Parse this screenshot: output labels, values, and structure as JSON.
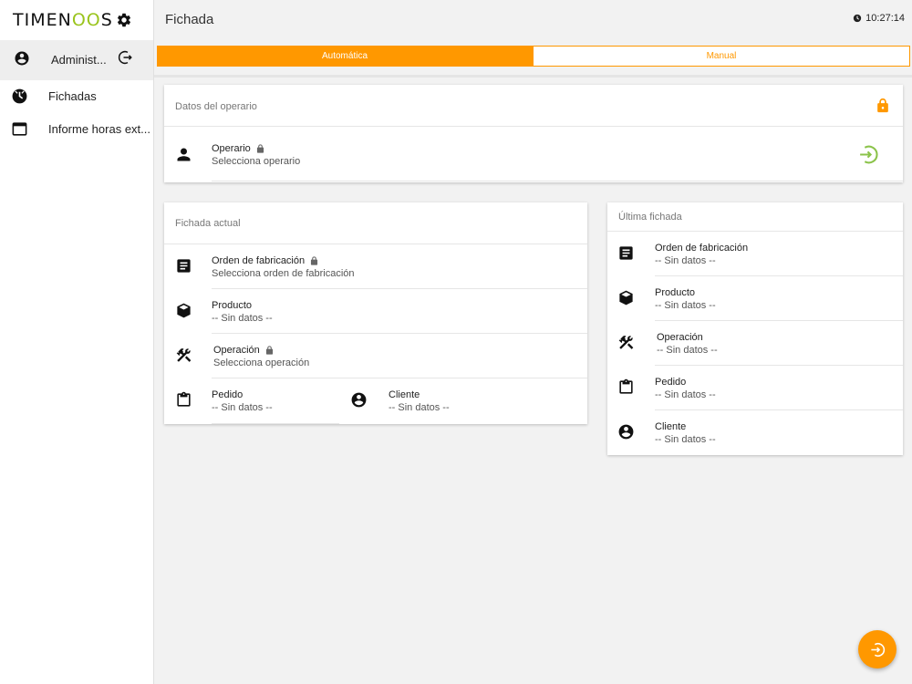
{
  "app": {
    "logo_prefix": "TIMEN",
    "logo_oo": "OO",
    "logo_suffix": "S"
  },
  "user": {
    "name": "Administ..."
  },
  "nav": [
    {
      "label": "Fichadas",
      "icon": "clock-icon"
    },
    {
      "label": "Informe horas ext...",
      "icon": "window-icon"
    }
  ],
  "header": {
    "title": "Fichada",
    "time": "10:27:14"
  },
  "tabs": [
    {
      "label": "Automática",
      "active": true
    },
    {
      "label": "Manual",
      "active": false
    }
  ],
  "operario_card": {
    "title": "Datos del operario",
    "row": {
      "label": "Operario",
      "value": "Selecciona operario"
    }
  },
  "actual_card": {
    "title": "Fichada actual",
    "orden": {
      "label": "Orden de fabricación",
      "value": "Selecciona orden de fabricación"
    },
    "producto": {
      "label": "Producto",
      "value": "-- Sin datos --"
    },
    "operacion": {
      "label": "Operación",
      "value": "Selecciona operación"
    },
    "pedido": {
      "label": "Pedido",
      "value": "-- Sin datos --"
    },
    "cliente": {
      "label": "Cliente",
      "value": "-- Sin datos --"
    }
  },
  "ultima_card": {
    "title": "Última fichada",
    "orden": {
      "label": "Orden de fabricación",
      "value": "-- Sin datos --"
    },
    "producto": {
      "label": "Producto",
      "value": "-- Sin datos --"
    },
    "operacion": {
      "label": "Operación",
      "value": "-- Sin datos --"
    },
    "pedido": {
      "label": "Pedido",
      "value": "-- Sin datos --"
    },
    "cliente": {
      "label": "Cliente",
      "value": "-- Sin datos --"
    }
  },
  "colors": {
    "accent": "#ff9800",
    "success": "#8bc34a",
    "brand_green": "#9ac41d"
  }
}
